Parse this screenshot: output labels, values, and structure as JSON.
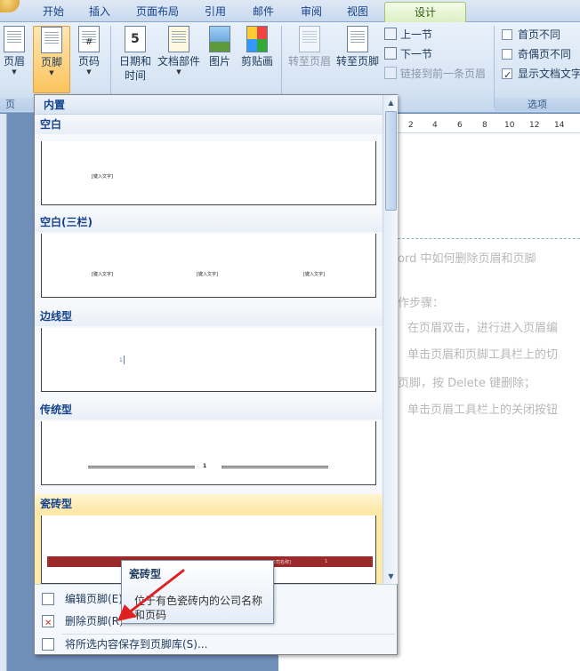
{
  "tabs": [
    {
      "label": "开始"
    },
    {
      "label": "插入"
    },
    {
      "label": "页面布局"
    },
    {
      "label": "引用"
    },
    {
      "label": "邮件"
    },
    {
      "label": "审阅"
    },
    {
      "label": "视图"
    },
    {
      "label": "设计"
    }
  ],
  "ribbon": {
    "header_label": "页眉",
    "footer_label": "页脚",
    "page_number_label": "页码",
    "group_partial_label": "页",
    "datetime_label_line1": "日期和",
    "datetime_label_line2": "时间",
    "parts_label": "文档部件",
    "picture_label": "图片",
    "clipart_label": "剪贴画",
    "goto_header_label": "转至页眉",
    "goto_footer_label": "转至页脚",
    "prev_section_label": "上一节",
    "next_section_label": "下一节",
    "link_previous_label": "链接到前一条页眉",
    "options": {
      "first_page_label": "首页不同",
      "odd_even_label": "奇偶页不同",
      "show_text_label": "显示文档文字",
      "first_page_checked": false,
      "odd_even_checked": false,
      "show_text_checked": true,
      "group_label": "选项"
    }
  },
  "ruler": {
    "ticks": [
      "2",
      "4",
      "6",
      "8",
      "10",
      "12",
      "14"
    ]
  },
  "document": {
    "line1": "ord 中如何删除页眉和页脚",
    "line2": "作步骤：",
    "line3": "在页眉双击，进行进入页眉编",
    "line4": "单击页眉和页脚工具栏上的切",
    "line5": "页脚，按 Delete 键删除；",
    "line6": "单击页眉工具栏上的关闭按钮"
  },
  "gallery": {
    "section_label": "内置",
    "items": [
      {
        "title": "空白",
        "ph1": "[键入文字]"
      },
      {
        "title": "空白(三栏)",
        "ph1": "[键入文字]",
        "ph2": "[键入文字]",
        "ph3": "[键入文字]"
      },
      {
        "title": "边线型",
        "ph1": "1"
      },
      {
        "title": "传统型",
        "ph1": "1"
      },
      {
        "title": "瓷砖型",
        "ph1": "[公司名称]",
        "ph2": "1"
      }
    ],
    "footer_items": [
      {
        "label": "编辑页脚(E)"
      },
      {
        "label": "删除页脚(R)"
      },
      {
        "label": "将所选内容保存到页脚库(S)..."
      }
    ]
  },
  "tooltip": {
    "title": "瓷砖型",
    "description": "位于有色瓷砖内的公司名称和页码"
  },
  "colors": {
    "accent": "#15428b",
    "annotation_arrow": "#e02020",
    "brick_bar": "#9b2a2a"
  }
}
